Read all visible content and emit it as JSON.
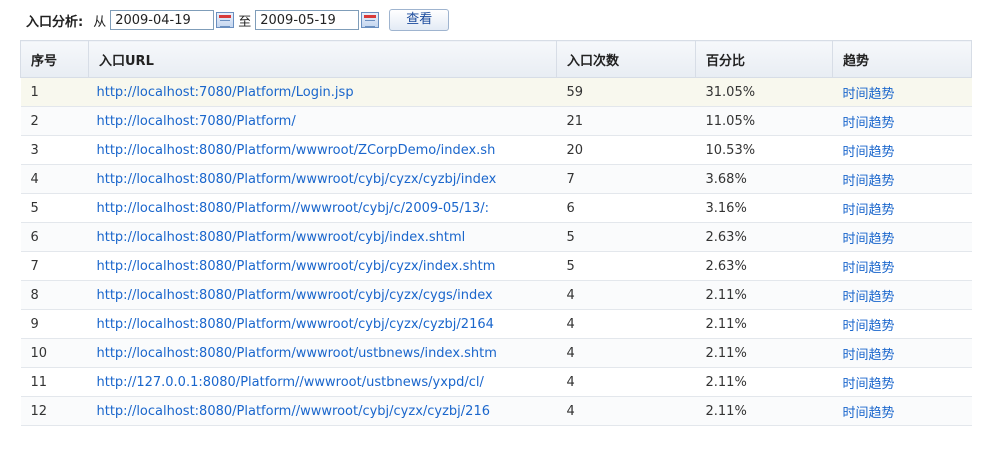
{
  "filter": {
    "title": "入口分析:",
    "from_label": "从",
    "from_date": "2009-04-19",
    "to_label": "至",
    "to_date": "2009-05-19",
    "view_button": "查看"
  },
  "table": {
    "headers": [
      "序号",
      "入口URL",
      "入口次数",
      "百分比",
      "趋势"
    ],
    "rows": [
      {
        "no": "1",
        "url": "http://localhost:7080/Platform/Login.jsp",
        "count": "59",
        "percent": "31.05%",
        "trend": "时间趋势"
      },
      {
        "no": "2",
        "url": "http://localhost:7080/Platform/",
        "count": "21",
        "percent": "11.05%",
        "trend": "时间趋势"
      },
      {
        "no": "3",
        "url": "http://localhost:8080/Platform/wwwroot/ZCorpDemo/index.sh",
        "count": "20",
        "percent": "10.53%",
        "trend": "时间趋势"
      },
      {
        "no": "4",
        "url": "http://localhost:8080/Platform/wwwroot/cybj/cyzx/cyzbj/index",
        "count": "7",
        "percent": "3.68%",
        "trend": "时间趋势"
      },
      {
        "no": "5",
        "url": "http://localhost:8080/Platform//wwwroot/cybj/c/2009-05/13/:",
        "count": "6",
        "percent": "3.16%",
        "trend": "时间趋势"
      },
      {
        "no": "6",
        "url": "http://localhost:8080/Platform/wwwroot/cybj/index.shtml",
        "count": "5",
        "percent": "2.63%",
        "trend": "时间趋势"
      },
      {
        "no": "7",
        "url": "http://localhost:8080/Platform/wwwroot/cybj/cyzx/index.shtm",
        "count": "5",
        "percent": "2.63%",
        "trend": "时间趋势"
      },
      {
        "no": "8",
        "url": "http://localhost:8080/Platform/wwwroot/cybj/cyzx/cygs/index",
        "count": "4",
        "percent": "2.11%",
        "trend": "时间趋势"
      },
      {
        "no": "9",
        "url": "http://localhost:8080/Platform/wwwroot/cybj/cyzx/cyzbj/2164",
        "count": "4",
        "percent": "2.11%",
        "trend": "时间趋势"
      },
      {
        "no": "10",
        "url": "http://localhost:8080/Platform/wwwroot/ustbnews/index.shtm",
        "count": "4",
        "percent": "2.11%",
        "trend": "时间趋势"
      },
      {
        "no": "11",
        "url": "http://127.0.0.1:8080/Platform//wwwroot/ustbnews/yxpd/cl/",
        "count": "4",
        "percent": "2.11%",
        "trend": "时间趋势"
      },
      {
        "no": "12",
        "url": "http://localhost:8080/Platform//wwwroot/cybj/cyzx/cyzbj/216",
        "count": "4",
        "percent": "2.11%",
        "trend": "时间趋势"
      }
    ]
  },
  "colors": {
    "link": "#1a66cc",
    "header_bg": "#eef1f5"
  },
  "icons": {
    "calendar": "calendar-icon"
  }
}
